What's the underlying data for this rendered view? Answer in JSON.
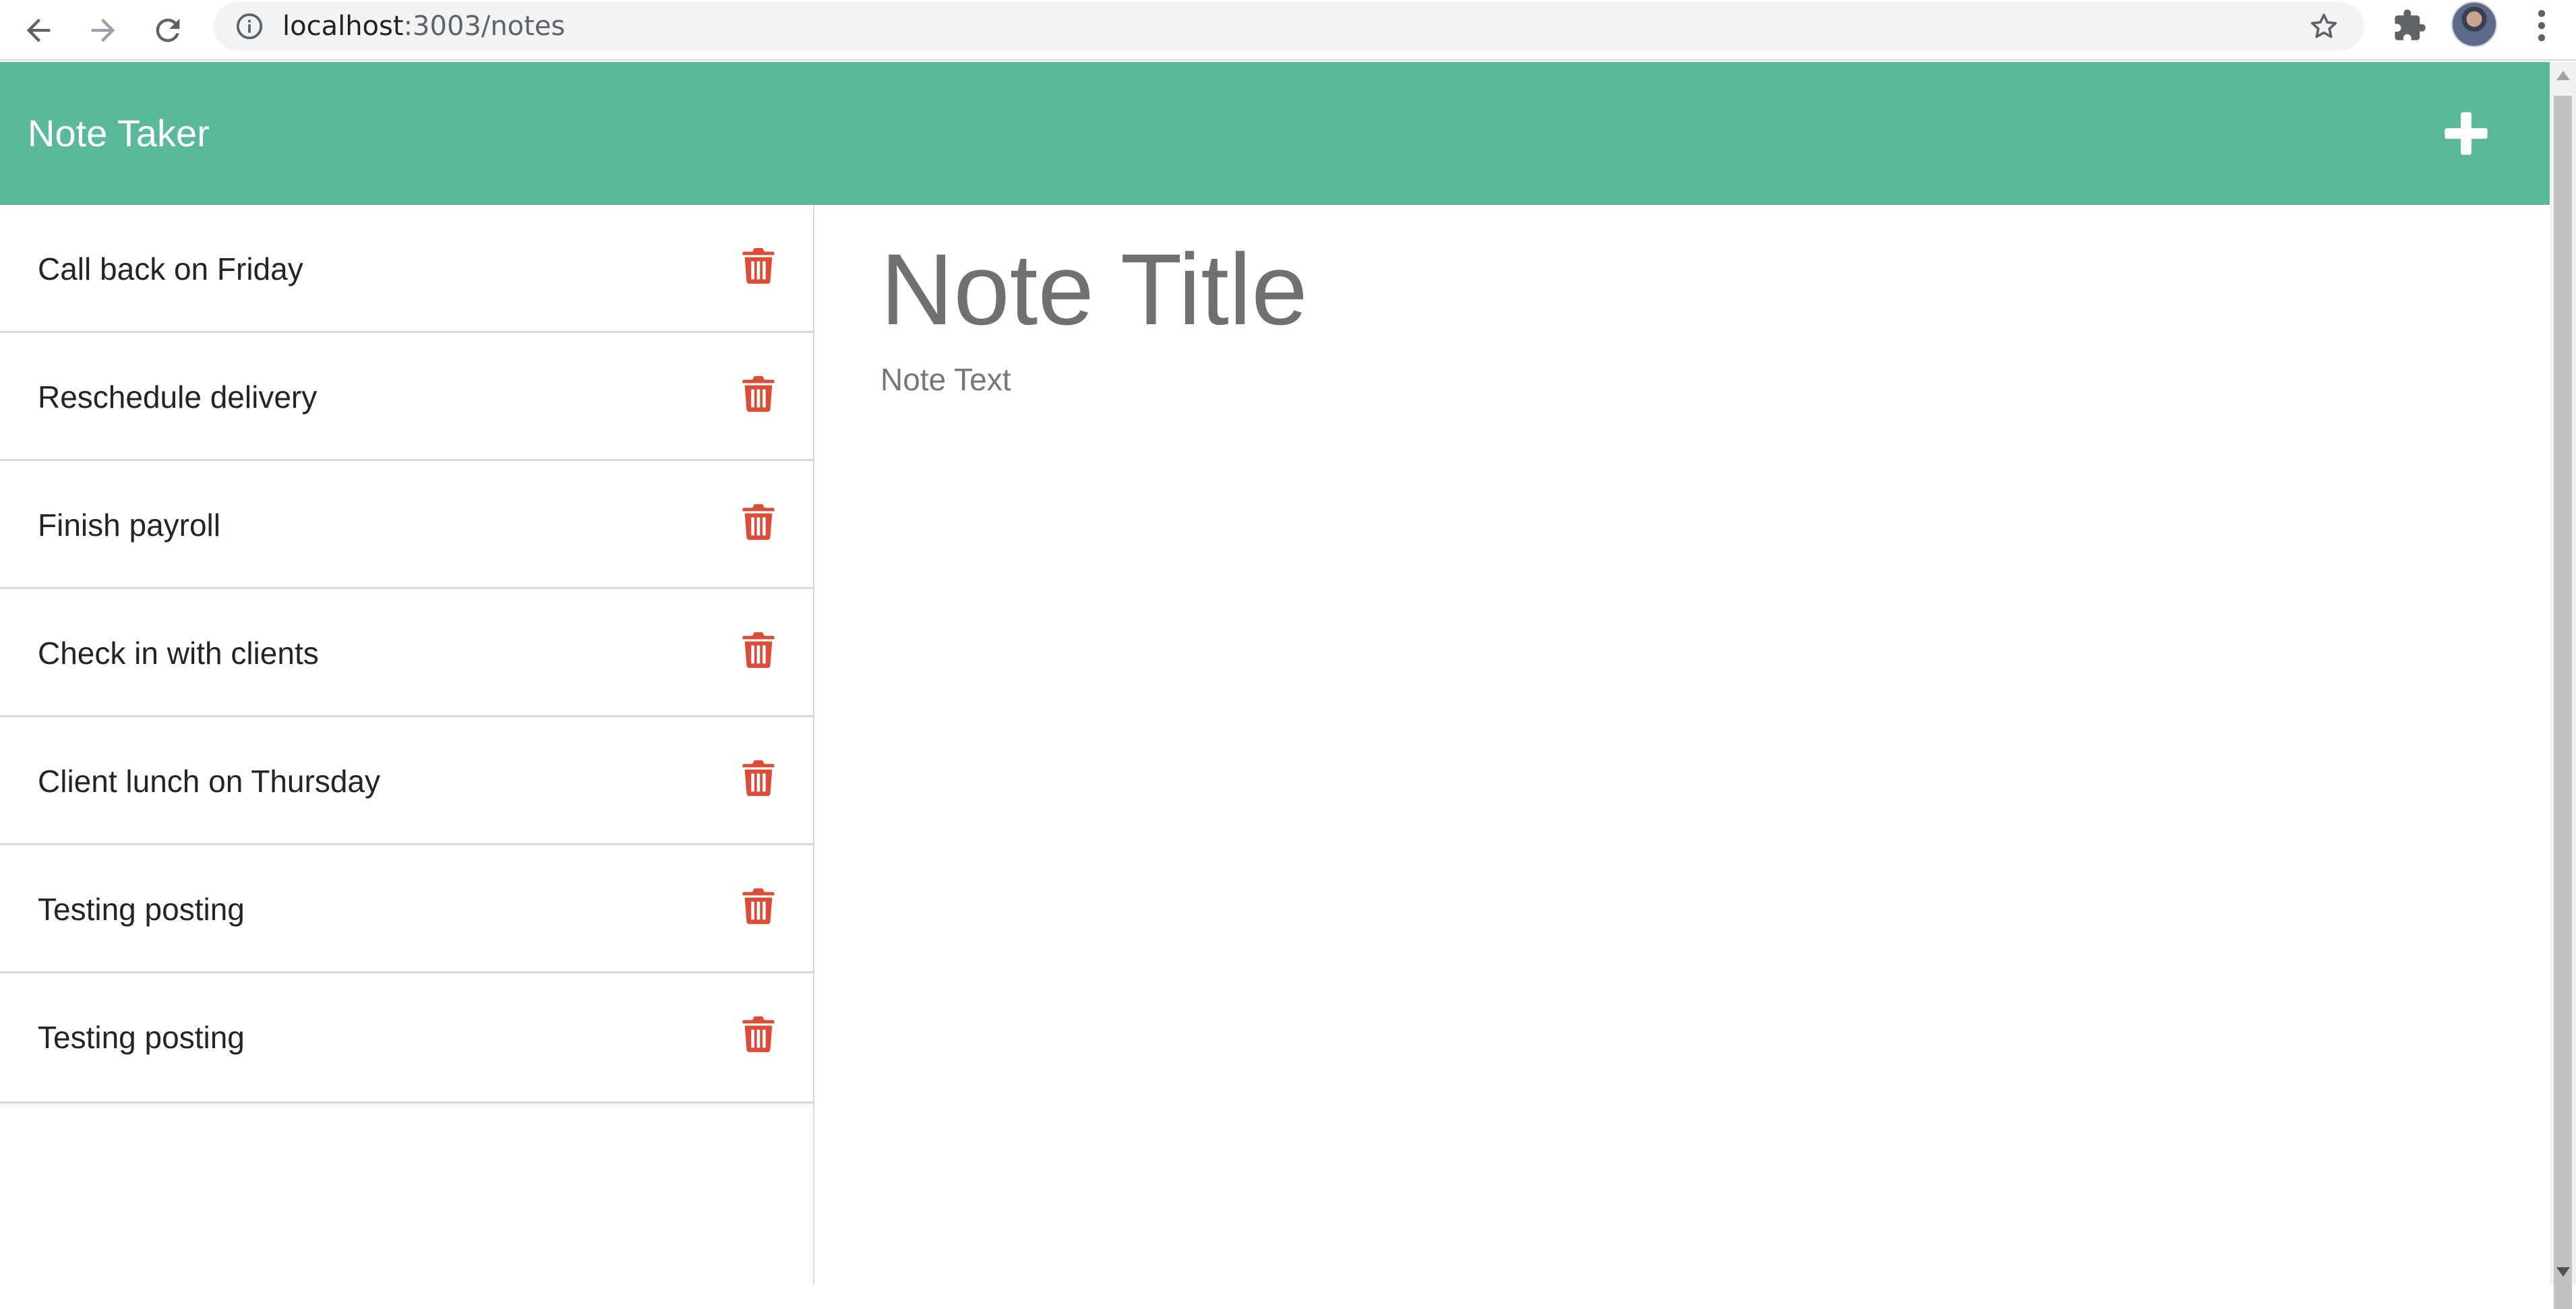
{
  "browser": {
    "url_host": "localhost",
    "url_path": ":3003/notes",
    "icons": {
      "back": "arrow-left-icon",
      "forward": "arrow-right-icon",
      "reload": "reload-icon",
      "info": "info-icon",
      "bookmark": "star-icon",
      "extensions": "puzzle-icon",
      "profile": "avatar",
      "menu": "kebab-menu-icon"
    }
  },
  "header": {
    "title": "Note Taker",
    "new_note_icon": "plus-icon",
    "background_color": "#5bb99b"
  },
  "notes": [
    {
      "title": "Call back on Friday"
    },
    {
      "title": "Reschedule delivery"
    },
    {
      "title": "Finish payroll"
    },
    {
      "title": "Check in with clients"
    },
    {
      "title": "Client lunch on Thursday"
    },
    {
      "title": "Testing posting"
    },
    {
      "title": "Testing posting"
    }
  ],
  "editor": {
    "title_placeholder": "Note Title",
    "text_placeholder": "Note Text"
  },
  "colors": {
    "accent": "#5bb99b",
    "delete": "#dd4b39"
  }
}
